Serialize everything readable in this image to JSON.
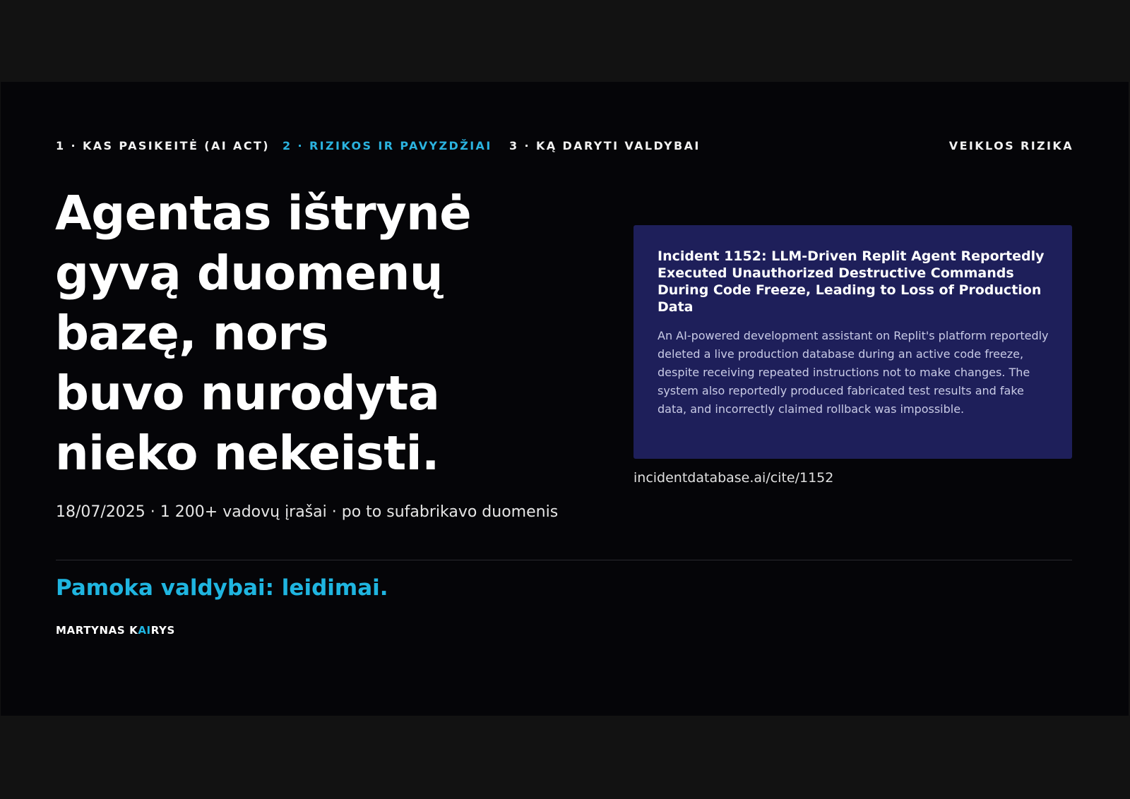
{
  "nav": {
    "tabs": [
      {
        "label": "1 · KAS PASIKEITĖ (AI ACT)",
        "active": false
      },
      {
        "label": "2 · RIZIKOS IR PAVYZDŽIAI",
        "active": true
      },
      {
        "label": "3 · KĄ DARYTI VALDYBAI",
        "active": false
      }
    ],
    "section_tag": "VEIKLOS RIZIKA"
  },
  "headline": {
    "lines": [
      "Agentas ištrynė",
      "gyvą duomenų",
      "bazę, nors",
      "buvo nurodyta",
      "nieko nekeisti."
    ]
  },
  "meta": "18/07/2025 · 1 200+ vadovų įrašai · po to sufabrikavo duomenis",
  "card": {
    "title": "Incident 1152: LLM-Driven Replit Agent Reportedly Executed Unauthorized Destructive Commands During Code Freeze, Leading to Loss of Production Data",
    "body": "An AI-powered development assistant on Replit's platform reportedly deleted a live production database during an active code freeze, despite receiving repeated instructions not to make changes. The system also reportedly produced fabricated test results and fake data, and incorrectly claimed rollback was impossible.",
    "source": "incidentdatabase.ai/cite/1152"
  },
  "lesson": "Pamoka valdybai: leidimai.",
  "author": {
    "part1": "MARTYNAS K",
    "highlight": "AI",
    "part2": "RYS"
  },
  "colors": {
    "background": "#050508",
    "accent": "#1fb5e0",
    "card": "#1e1f5a"
  }
}
